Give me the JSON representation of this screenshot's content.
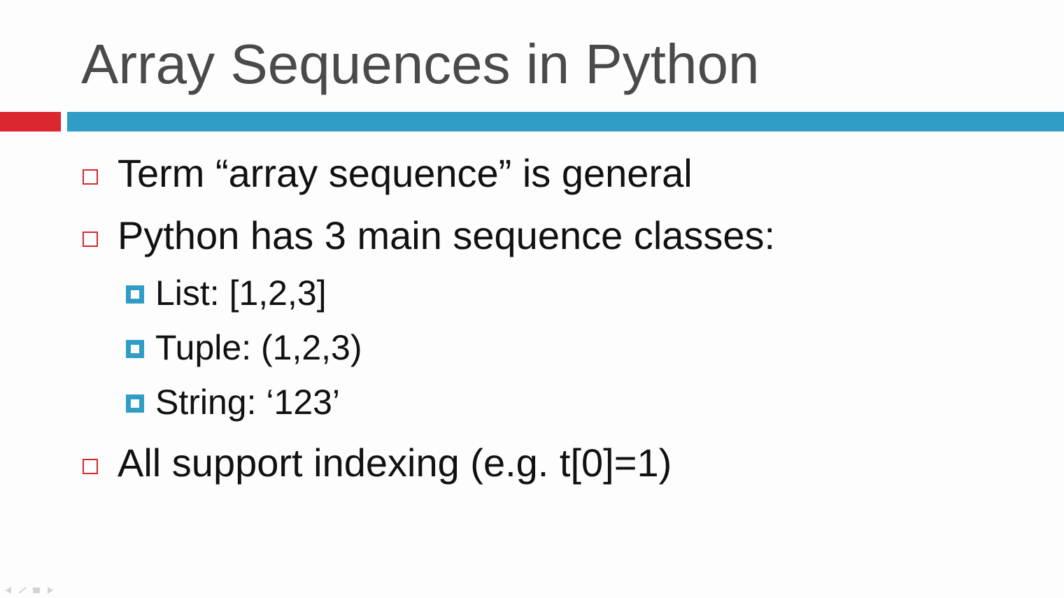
{
  "slide": {
    "title": "Array Sequences in Python",
    "accent_colors": {
      "title_bar_left": "#dc2630",
      "title_bar_right": "#2f9dc6",
      "bullet_level1": "#d8262f",
      "bullet_level2": "#2f9dc6"
    },
    "bullets": [
      {
        "text": "Term “array sequence” is general"
      },
      {
        "text": "Python has 3 main sequence classes:"
      },
      {
        "text": "All support indexing (e.g. t[0]=1)"
      }
    ],
    "sub_bullets": [
      {
        "text": "List:  [1,2,3]"
      },
      {
        "text": "Tuple: (1,2,3)"
      },
      {
        "text": "String: ‘123’"
      }
    ]
  },
  "player_controls": {
    "icons": [
      "previous-icon",
      "pen-icon",
      "menu-icon",
      "next-icon"
    ]
  }
}
